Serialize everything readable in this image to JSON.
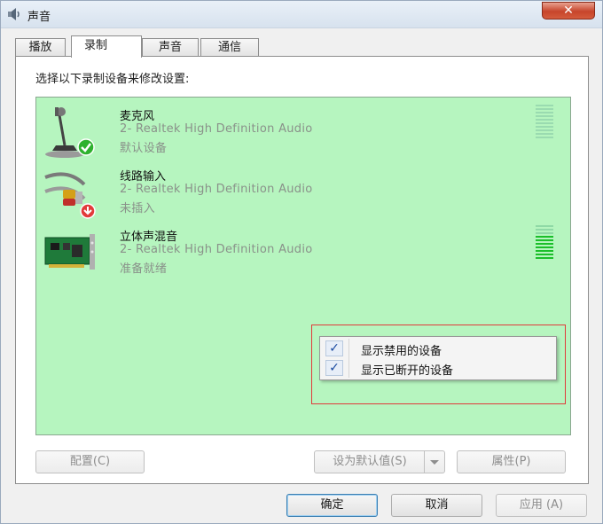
{
  "window": {
    "title": "声音",
    "close_glyph": "✕"
  },
  "tabs": [
    {
      "label": "播放"
    },
    {
      "label": "录制"
    },
    {
      "label": "声音"
    },
    {
      "label": "通信"
    }
  ],
  "active_tab": "录制",
  "instruction": "选择以下录制设备来修改设置:",
  "devices": [
    {
      "name": "麦克风",
      "driver": "2- Realtek High Definition Audio",
      "status": "默认设备",
      "icon": "microphone-icon",
      "badge": "default-check-icon"
    },
    {
      "name": "线路输入",
      "driver": "2- Realtek High Definition Audio",
      "status": "未插入",
      "icon": "line-in-cable-icon",
      "badge": "unplugged-icon"
    },
    {
      "name": "立体声混音",
      "driver": "2- Realtek High Definition Audio",
      "status": "准备就绪",
      "icon": "sound-card-icon",
      "badge": ""
    }
  ],
  "context_menu": {
    "items": [
      {
        "label": "显示禁用的设备",
        "checked": true
      },
      {
        "label": "显示已断开的设备",
        "checked": true
      }
    ],
    "check_glyph": "✓"
  },
  "buttons": {
    "configure": "配置(C)",
    "set_default": "设为默认值(S)",
    "properties": "属性(P)",
    "ok": "确定",
    "cancel": "取消",
    "apply": "应用 (A)"
  },
  "colors": {
    "list_bg": "#b6f5bf",
    "highlight_box": "#e03a3a",
    "meter_active": "#1bbf2a"
  }
}
